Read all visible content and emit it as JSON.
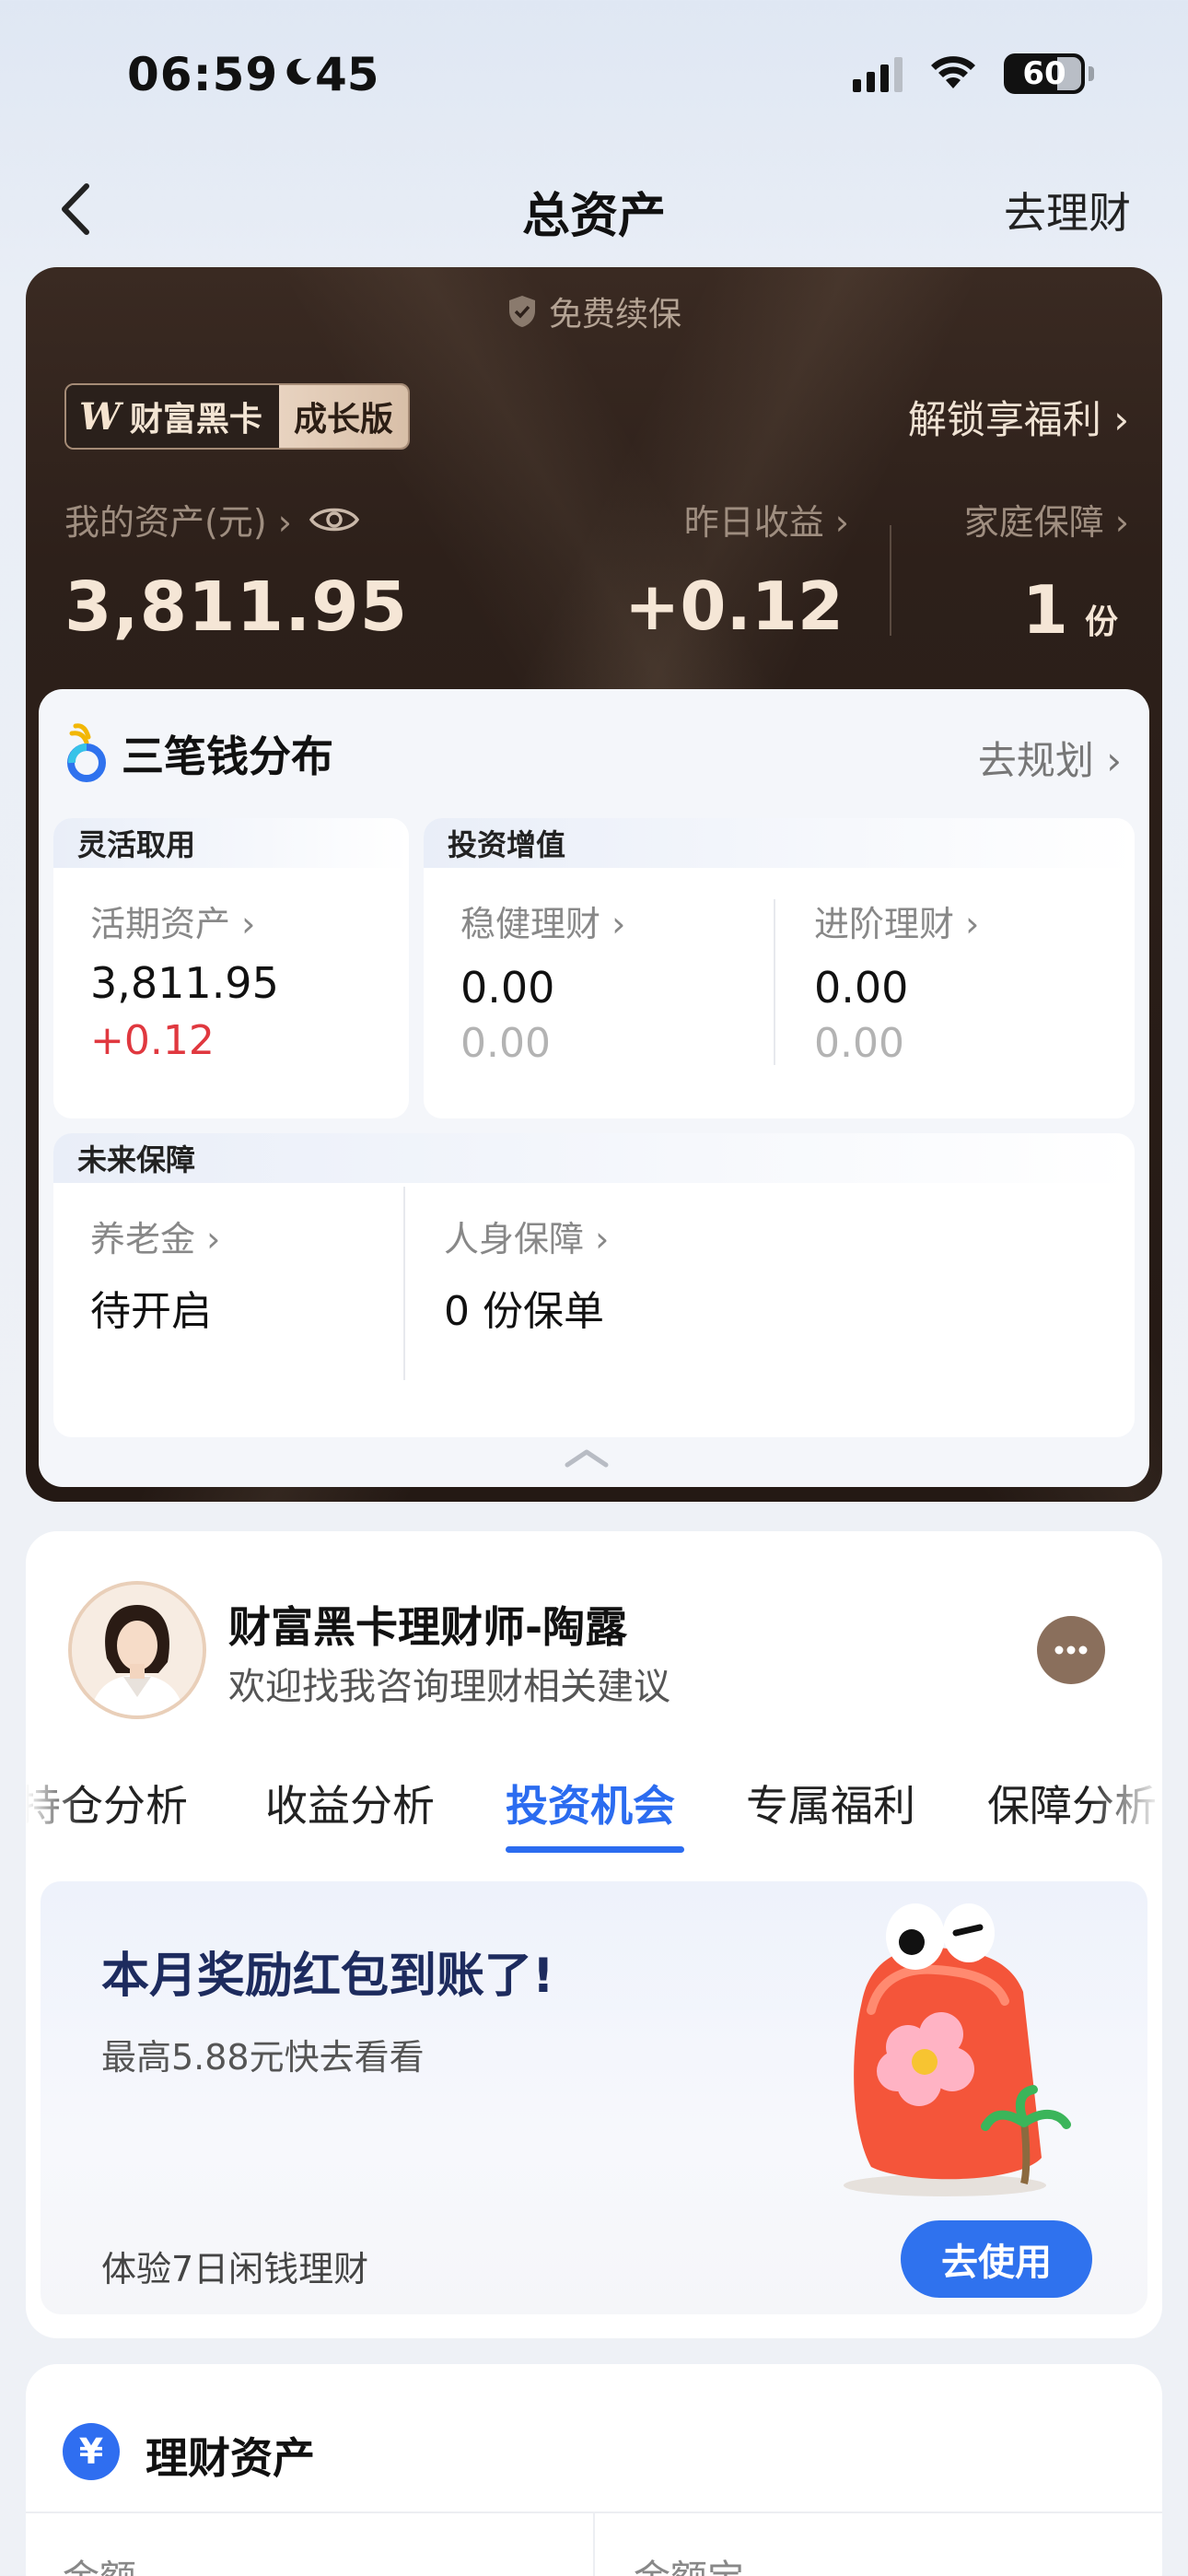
{
  "status": {
    "time": "06:59",
    "battery": "60"
  },
  "nav": {
    "title": "总资产",
    "right_link": "去理财"
  },
  "black_card": {
    "renew": "免费续保",
    "badge_logo": "W",
    "badge_name": "财富黑卡",
    "badge_level": "成长版",
    "unlock": "解锁享福利 ›",
    "assets_label": "我的资产(元) ›",
    "assets_value": "3,811.95",
    "yesterday_label": "昨日收益 ›",
    "yesterday_value": "+0.12",
    "family_label": "家庭保障 ›",
    "family_value": "1",
    "family_unit": "份"
  },
  "distribution": {
    "title": "三笔钱分布",
    "plan_link": "去规划 ›",
    "flexible": {
      "head": "灵活取用",
      "label": "活期资产 ›",
      "value": "3,811.95",
      "change": "+0.12"
    },
    "invest": {
      "head": "投资增值",
      "items": [
        {
          "label": "稳健理财 ›",
          "value": "0.00",
          "sub": "0.00"
        },
        {
          "label": "进阶理财 ›",
          "value": "0.00",
          "sub": "0.00"
        }
      ]
    },
    "future": {
      "head": "未来保障",
      "items": [
        {
          "label": "养老金 ›",
          "value": "待开启"
        },
        {
          "label": "人身保障 ›",
          "value": "0 份保单"
        }
      ]
    }
  },
  "advisor": {
    "name": "财富黑卡理财师-陶露",
    "subtitle": "欢迎找我咨询理财相关建议",
    "tabs": [
      "持仓分析",
      "收益分析",
      "投资机会",
      "专属福利",
      "保障分析"
    ],
    "active_tab": "投资机会"
  },
  "promo": {
    "title": "本月奖励红包到账了!",
    "subtitle": "最高5.88元快去看看",
    "footer": "体验7日闲钱理财",
    "button": "去使用"
  },
  "wealth_assets": {
    "icon": "¥",
    "title": "理财资产",
    "col1": "金额",
    "col2": "金额宝"
  },
  "colors": {
    "accent_blue": "#2f72ee",
    "gain_red": "#e0383f",
    "card_dark": "#2d201a"
  }
}
